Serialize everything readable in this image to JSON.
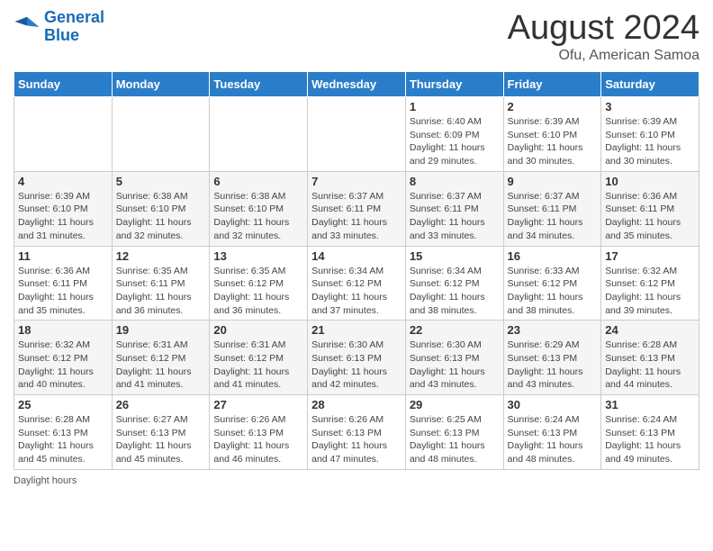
{
  "header": {
    "logo_line1": "General",
    "logo_line2": "Blue",
    "main_title": "August 2024",
    "sub_title": "Ofu, American Samoa"
  },
  "days_of_week": [
    "Sunday",
    "Monday",
    "Tuesday",
    "Wednesday",
    "Thursday",
    "Friday",
    "Saturday"
  ],
  "weeks": [
    [
      {
        "day": "",
        "info": ""
      },
      {
        "day": "",
        "info": ""
      },
      {
        "day": "",
        "info": ""
      },
      {
        "day": "",
        "info": ""
      },
      {
        "day": "1",
        "info": "Sunrise: 6:40 AM\nSunset: 6:09 PM\nDaylight: 11 hours and 29 minutes."
      },
      {
        "day": "2",
        "info": "Sunrise: 6:39 AM\nSunset: 6:10 PM\nDaylight: 11 hours and 30 minutes."
      },
      {
        "day": "3",
        "info": "Sunrise: 6:39 AM\nSunset: 6:10 PM\nDaylight: 11 hours and 30 minutes."
      }
    ],
    [
      {
        "day": "4",
        "info": "Sunrise: 6:39 AM\nSunset: 6:10 PM\nDaylight: 11 hours and 31 minutes."
      },
      {
        "day": "5",
        "info": "Sunrise: 6:38 AM\nSunset: 6:10 PM\nDaylight: 11 hours and 32 minutes."
      },
      {
        "day": "6",
        "info": "Sunrise: 6:38 AM\nSunset: 6:10 PM\nDaylight: 11 hours and 32 minutes."
      },
      {
        "day": "7",
        "info": "Sunrise: 6:37 AM\nSunset: 6:11 PM\nDaylight: 11 hours and 33 minutes."
      },
      {
        "day": "8",
        "info": "Sunrise: 6:37 AM\nSunset: 6:11 PM\nDaylight: 11 hours and 33 minutes."
      },
      {
        "day": "9",
        "info": "Sunrise: 6:37 AM\nSunset: 6:11 PM\nDaylight: 11 hours and 34 minutes."
      },
      {
        "day": "10",
        "info": "Sunrise: 6:36 AM\nSunset: 6:11 PM\nDaylight: 11 hours and 35 minutes."
      }
    ],
    [
      {
        "day": "11",
        "info": "Sunrise: 6:36 AM\nSunset: 6:11 PM\nDaylight: 11 hours and 35 minutes."
      },
      {
        "day": "12",
        "info": "Sunrise: 6:35 AM\nSunset: 6:11 PM\nDaylight: 11 hours and 36 minutes."
      },
      {
        "day": "13",
        "info": "Sunrise: 6:35 AM\nSunset: 6:12 PM\nDaylight: 11 hours and 36 minutes."
      },
      {
        "day": "14",
        "info": "Sunrise: 6:34 AM\nSunset: 6:12 PM\nDaylight: 11 hours and 37 minutes."
      },
      {
        "day": "15",
        "info": "Sunrise: 6:34 AM\nSunset: 6:12 PM\nDaylight: 11 hours and 38 minutes."
      },
      {
        "day": "16",
        "info": "Sunrise: 6:33 AM\nSunset: 6:12 PM\nDaylight: 11 hours and 38 minutes."
      },
      {
        "day": "17",
        "info": "Sunrise: 6:32 AM\nSunset: 6:12 PM\nDaylight: 11 hours and 39 minutes."
      }
    ],
    [
      {
        "day": "18",
        "info": "Sunrise: 6:32 AM\nSunset: 6:12 PM\nDaylight: 11 hours and 40 minutes."
      },
      {
        "day": "19",
        "info": "Sunrise: 6:31 AM\nSunset: 6:12 PM\nDaylight: 11 hours and 41 minutes."
      },
      {
        "day": "20",
        "info": "Sunrise: 6:31 AM\nSunset: 6:12 PM\nDaylight: 11 hours and 41 minutes."
      },
      {
        "day": "21",
        "info": "Sunrise: 6:30 AM\nSunset: 6:13 PM\nDaylight: 11 hours and 42 minutes."
      },
      {
        "day": "22",
        "info": "Sunrise: 6:30 AM\nSunset: 6:13 PM\nDaylight: 11 hours and 43 minutes."
      },
      {
        "day": "23",
        "info": "Sunrise: 6:29 AM\nSunset: 6:13 PM\nDaylight: 11 hours and 43 minutes."
      },
      {
        "day": "24",
        "info": "Sunrise: 6:28 AM\nSunset: 6:13 PM\nDaylight: 11 hours and 44 minutes."
      }
    ],
    [
      {
        "day": "25",
        "info": "Sunrise: 6:28 AM\nSunset: 6:13 PM\nDaylight: 11 hours and 45 minutes."
      },
      {
        "day": "26",
        "info": "Sunrise: 6:27 AM\nSunset: 6:13 PM\nDaylight: 11 hours and 45 minutes."
      },
      {
        "day": "27",
        "info": "Sunrise: 6:26 AM\nSunset: 6:13 PM\nDaylight: 11 hours and 46 minutes."
      },
      {
        "day": "28",
        "info": "Sunrise: 6:26 AM\nSunset: 6:13 PM\nDaylight: 11 hours and 47 minutes."
      },
      {
        "day": "29",
        "info": "Sunrise: 6:25 AM\nSunset: 6:13 PM\nDaylight: 11 hours and 48 minutes."
      },
      {
        "day": "30",
        "info": "Sunrise: 6:24 AM\nSunset: 6:13 PM\nDaylight: 11 hours and 48 minutes."
      },
      {
        "day": "31",
        "info": "Sunrise: 6:24 AM\nSunset: 6:13 PM\nDaylight: 11 hours and 49 minutes."
      }
    ]
  ],
  "footer": {
    "daylight_label": "Daylight hours"
  }
}
